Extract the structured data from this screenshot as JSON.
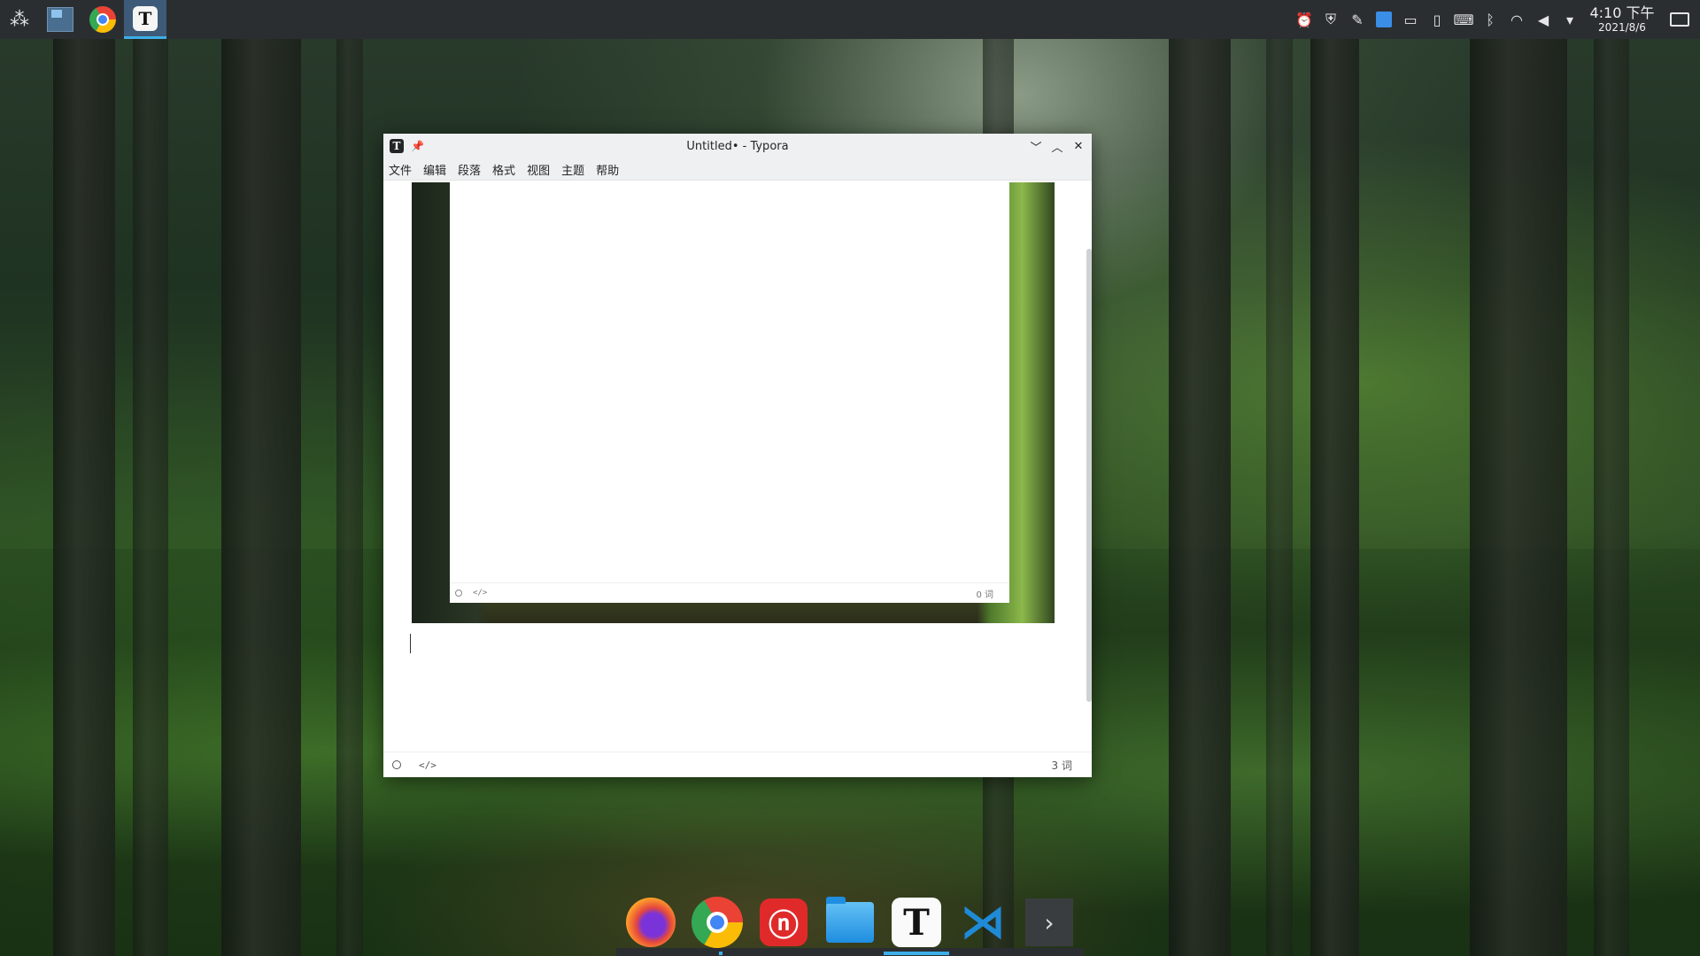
{
  "top_panel": {
    "launcher_icon": "kde-launcher-icon",
    "tasks": [
      {
        "name": "desktop-icon"
      },
      {
        "name": "chrome-icon"
      },
      {
        "name": "typora-icon",
        "label": "T",
        "active": true
      }
    ],
    "tray_icons": [
      "bell-icon",
      "shield-icon",
      "feather-icon",
      "clipboard-app-icon",
      "terminal-icon",
      "battery-icon",
      "keyboard-icon",
      "bluetooth-icon",
      "wifi-icon",
      "volume-icon",
      "expand-arrow-icon"
    ],
    "clock": {
      "time": "4:10 下午",
      "date": "2021/8/6"
    },
    "accent_color": "#3daee9"
  },
  "window": {
    "icon_letter": "T",
    "pin_glyph": "📌",
    "title": "Untitled• - Typora",
    "controls": {
      "minimize": "﹀",
      "maximize": "︿",
      "close": "✕"
    },
    "menu": [
      "文件",
      "编辑",
      "段落",
      "格式",
      "视图",
      "主题",
      "帮助"
    ],
    "embedded_screenshot": {
      "status_left_icons": [
        "circle-icon",
        "code-icon"
      ],
      "code_glyph": "</>",
      "word_count": "0 词"
    },
    "status_bar": {
      "code_glyph": "</>",
      "word_count": "3 词"
    }
  },
  "dock": {
    "items": [
      {
        "name": "firefox"
      },
      {
        "name": "chrome"
      },
      {
        "name": "netease-music",
        "glyph": "ⓝ"
      },
      {
        "name": "files"
      },
      {
        "name": "typora",
        "glyph": "T"
      },
      {
        "name": "vscode",
        "glyph": "⋊"
      },
      {
        "name": "more",
        "glyph": "›"
      }
    ]
  }
}
